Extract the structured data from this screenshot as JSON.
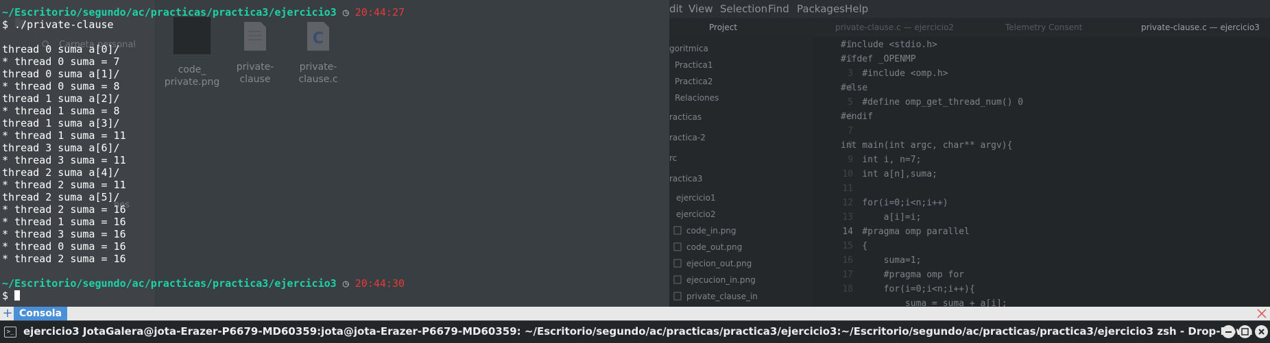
{
  "file_manager": {
    "sidebar": [
      "Carpeta personal",
      "nes"
    ],
    "files": [
      {
        "name": "code_\nprivate.png",
        "type": "image"
      },
      {
        "name": "private-\nclause",
        "type": "binary"
      },
      {
        "name": "private-\nclause.c",
        "type": "c-source"
      }
    ]
  },
  "editor": {
    "menu": [
      "dit",
      "View",
      "Selection",
      "Find",
      "Packages",
      "Help"
    ],
    "tabs": [
      "Project",
      "private-clause.c — ejercicio2",
      "Telemetry Consent",
      "private-clause.c — ejercicio3"
    ],
    "tree": [
      "goritmica",
      "Practica1",
      "Practica2",
      "Relaciones",
      "racticas",
      "ractica-2",
      "rc",
      "ractica3",
      "ejercicio1",
      "ejercicio2",
      "code_in.png",
      "code_out.png",
      "ejecion_out.png",
      "ejecucion_in.png",
      "private_clause_in"
    ],
    "gutter": [
      "1",
      "2",
      "3",
      "4",
      "5",
      "6",
      "7",
      "8",
      "9",
      "10",
      "11",
      "12",
      "13",
      "14",
      "15",
      "16",
      "17",
      "18"
    ],
    "current_line": "14",
    "code": [
      "#include <stdio.h>",
      "#ifdef _OPENMP",
      "    #include <omp.h>",
      "#else",
      "    #define omp_get_thread_num() 0",
      "#endif",
      "",
      "int main(int argc, char** argv){",
      "    int i, n=7;",
      "    int a[n],suma;",
      "",
      "    for(i=0;i<n;i++)",
      "        a[i]=i;",
      "    #pragma omp parallel",
      "    {",
      "        suma=1;",
      "        #pragma omp for",
      "        for(i=0;i<n;i++){",
      "            suma = suma + a[i];"
    ]
  },
  "terminal": {
    "prompt1": {
      "path": "~/Escritorio/segundo/ac/practicas/practica3/ejercicio3",
      "clock": "◷",
      "time": "20:44:27"
    },
    "command_line": "$ ./private-clause",
    "output": [
      "thread 0 suma a[0]/",
      "* thread 0 suma = 7",
      "thread 0 suma a[1]/",
      "* thread 0 suma = 8",
      "thread 1 suma a[2]/",
      "* thread 1 suma = 8",
      "thread 1 suma a[3]/",
      "* thread 1 suma = 11",
      "thread 3 suma a[6]/",
      "* thread 3 suma = 11",
      "thread 2 suma a[4]/",
      "* thread 2 suma = 11",
      "thread 2 suma a[5]/",
      "* thread 2 suma = 16",
      "* thread 1 suma = 16",
      "* thread 3 suma = 16",
      "* thread 0 suma = 16",
      "* thread 2 suma = 16"
    ],
    "prompt2": {
      "path": "~/Escritorio/segundo/ac/practicas/practica3/ejercicio3",
      "clock": "◷",
      "time": "20:44:30"
    },
    "prompt_symbol": "$"
  },
  "guake_tabs": {
    "add": "+",
    "active_tab": "Consola"
  },
  "panel": {
    "window_title": "ejercicio3 JotaGalera@jota-Erazer-P6679-MD60359:jota@jota-Erazer-P6679-MD60359: ~/Escritorio/segundo/ac/practicas/practica3/ejercicio3:~/Escritorio/segundo/ac/practicas/practica3/ejercicio3 zsh - Drop-Down"
  },
  "colors": {
    "prompt_path": "#1dd3a7",
    "prompt_time": "#e83a3a",
    "tab_active": "#4a90d9",
    "terminal_text": "#ffffff"
  }
}
